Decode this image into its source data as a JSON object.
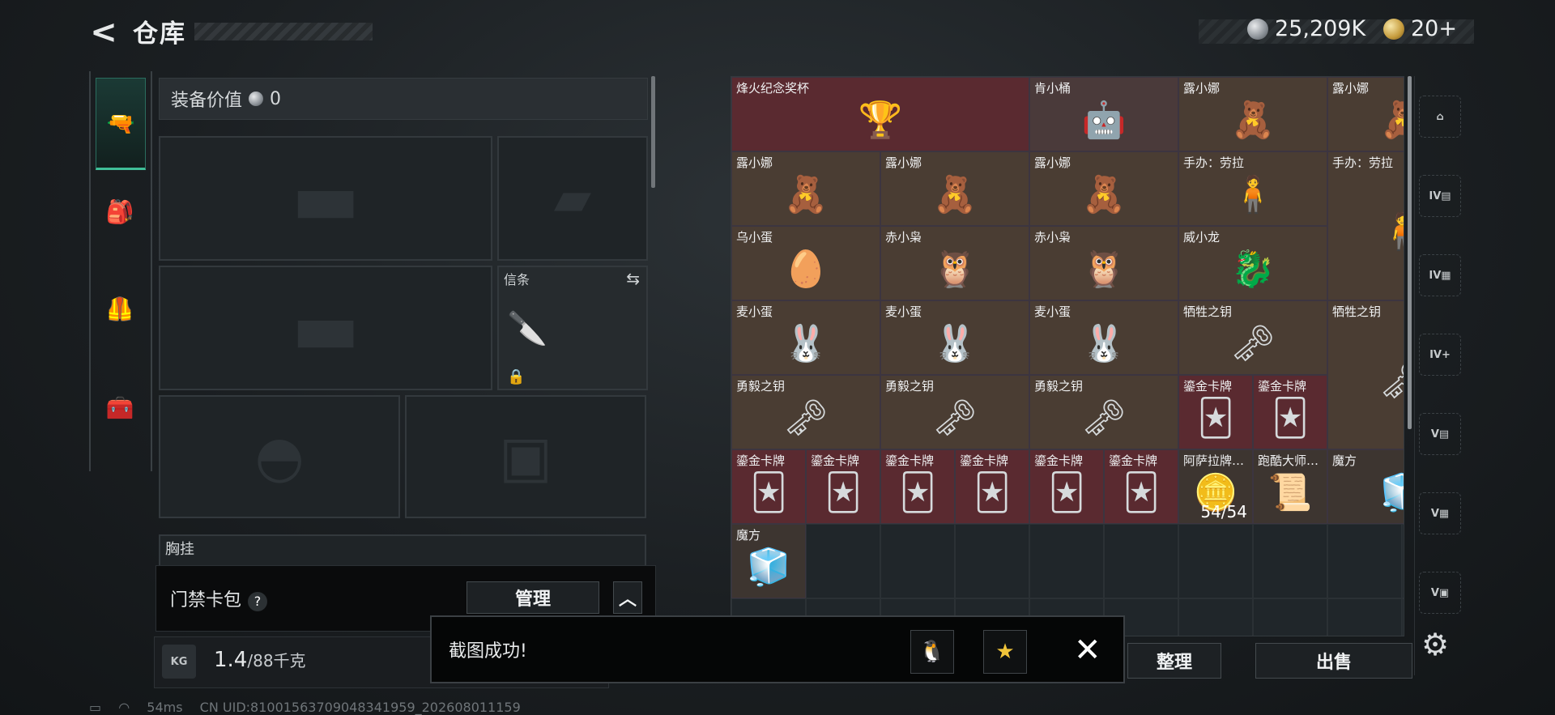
{
  "header": {
    "back_icon": "back-arrow-icon",
    "title": "仓库",
    "currency": [
      {
        "icon": "silver-coin-icon",
        "value": "25,209K"
      },
      {
        "icon": "gold-coin-icon",
        "value": "20+"
      }
    ]
  },
  "left_tabs": [
    {
      "icon": "pistol-icon",
      "glyph": "🔫",
      "active": true
    },
    {
      "icon": "backpack-icon",
      "glyph": "🎒",
      "active": false
    },
    {
      "icon": "vest-icon",
      "glyph": "🦺",
      "active": false
    },
    {
      "icon": "toolbox-icon",
      "glyph": "🧰",
      "active": false
    }
  ],
  "equipment": {
    "value_label": "装备价值",
    "value": "0",
    "signal_slot_label": "信条",
    "chest_label": "胸挂",
    "access_card_label": "门禁卡包",
    "help": "?",
    "manage_label": "管理",
    "collapse_glyph": "︿",
    "weight_icon_text": "KG",
    "weight_value": "1.4",
    "weight_max": "/88千克"
  },
  "items": [
    {
      "name": "烽火纪念奖杯",
      "glyph": "🏆",
      "color": "#5a2a30",
      "col": 0,
      "row": 0,
      "w": 2,
      "h": 1
    },
    {
      "name": "肯小桶",
      "glyph": "🤖",
      "color": "#4a3a3a",
      "col": 2,
      "row": 0,
      "w": 1,
      "h": 1
    },
    {
      "name": "露小娜",
      "glyph": "🧸",
      "color": "#4a3d33",
      "col": 3,
      "row": 0,
      "w": 1,
      "h": 1
    },
    {
      "name": "露小娜",
      "glyph": "🧸",
      "color": "#4a3d33",
      "col": 4,
      "row": 0,
      "w": 1,
      "h": 1
    },
    {
      "name": "露小娜",
      "glyph": "🧸",
      "color": "#4a3d33",
      "col": 0,
      "row": 1,
      "w": 1,
      "h": 1
    },
    {
      "name": "露小娜",
      "glyph": "🧸",
      "color": "#4a3d33",
      "col": 1,
      "row": 1,
      "w": 1,
      "h": 1
    },
    {
      "name": "露小娜",
      "glyph": "🧸",
      "color": "#4a3d33",
      "col": 2,
      "row": 1,
      "w": 1,
      "h": 1
    },
    {
      "name": "手办：劳拉",
      "glyph": "🧍",
      "color": "#4a3d33",
      "col": 3,
      "row": 1,
      "w": 1,
      "h": 1
    },
    {
      "name": "手办：劳拉",
      "glyph": "🧍",
      "color": "#4a3d33",
      "col": 4,
      "row": 1,
      "w": 1,
      "h": 2
    },
    {
      "name": "乌小蛋",
      "glyph": "🥚",
      "color": "#4a3d33",
      "col": 0,
      "row": 2,
      "w": 1,
      "h": 1
    },
    {
      "name": "赤小枭",
      "glyph": "🦉",
      "color": "#4a3d33",
      "col": 1,
      "row": 2,
      "w": 1,
      "h": 1
    },
    {
      "name": "赤小枭",
      "glyph": "🦉",
      "color": "#4a3d33",
      "col": 2,
      "row": 2,
      "w": 1,
      "h": 1
    },
    {
      "name": "威小龙",
      "glyph": "🐉",
      "color": "#4a3d33",
      "col": 3,
      "row": 2,
      "w": 1,
      "h": 1
    },
    {
      "name": "麦小蛋",
      "glyph": "🐰",
      "color": "#4a3d33",
      "col": 0,
      "row": 3,
      "w": 1,
      "h": 1
    },
    {
      "name": "麦小蛋",
      "glyph": "🐰",
      "color": "#4a3d33",
      "col": 1,
      "row": 3,
      "w": 1,
      "h": 1
    },
    {
      "name": "麦小蛋",
      "glyph": "🐰",
      "color": "#4a3d33",
      "col": 2,
      "row": 3,
      "w": 1,
      "h": 1
    },
    {
      "name": "牺牲之钥",
      "glyph": "🗝",
      "color": "#4a3d33",
      "col": 3,
      "row": 3,
      "w": 1,
      "h": 1
    },
    {
      "name": "牺牲之钥",
      "glyph": "🗝",
      "color": "#4a3d33",
      "col": 4,
      "row": 3,
      "w": 1,
      "h": 2
    },
    {
      "name": "勇毅之钥",
      "glyph": "🗝",
      "color": "#4a3d33",
      "col": 0,
      "row": 4,
      "w": 1,
      "h": 1
    },
    {
      "name": "勇毅之钥",
      "glyph": "🗝",
      "color": "#4a3d33",
      "col": 1,
      "row": 4,
      "w": 1,
      "h": 1
    },
    {
      "name": "勇毅之钥",
      "glyph": "🗝",
      "color": "#4a3d33",
      "col": 2,
      "row": 4,
      "w": 1,
      "h": 1
    },
    {
      "name": "鎏金卡牌",
      "glyph": "🃏",
      "color": "#5a2a30",
      "col": 3,
      "row": 4,
      "w": 0.5,
      "h": 1
    },
    {
      "name": "鎏金卡牌",
      "glyph": "🃏",
      "color": "#5a2a30",
      "col": 3.5,
      "row": 4,
      "w": 0.5,
      "h": 1
    },
    {
      "name": "鎏金卡牌",
      "glyph": "🃏",
      "color": "#5a2a30",
      "col": 0,
      "row": 5,
      "w": 0.5,
      "h": 1
    },
    {
      "name": "鎏金卡牌",
      "glyph": "🃏",
      "color": "#5a2a30",
      "col": 0.5,
      "row": 5,
      "w": 0.5,
      "h": 1
    },
    {
      "name": "鎏金卡牌",
      "glyph": "🃏",
      "color": "#5a2a30",
      "col": 1,
      "row": 5,
      "w": 0.5,
      "h": 1
    },
    {
      "name": "鎏金卡牌",
      "glyph": "🃏",
      "color": "#5a2a30",
      "col": 1.5,
      "row": 5,
      "w": 0.5,
      "h": 1
    },
    {
      "name": "鎏金卡牌",
      "glyph": "🃏",
      "color": "#5a2a30",
      "col": 2,
      "row": 5,
      "w": 0.5,
      "h": 1
    },
    {
      "name": "鎏金卡牌",
      "glyph": "🃏",
      "color": "#5a2a30",
      "col": 2.5,
      "row": 5,
      "w": 0.5,
      "h": 1
    },
    {
      "name": "阿萨拉牌…",
      "glyph": "🪙",
      "color": "#3d3530",
      "col": 3,
      "row": 5,
      "w": 0.5,
      "h": 1,
      "count": "54/54"
    },
    {
      "name": "跑酷大师…",
      "glyph": "📜",
      "color": "#3d3530",
      "col": 3.5,
      "row": 5,
      "w": 0.5,
      "h": 1
    },
    {
      "name": "魔方",
      "glyph": "🧊",
      "color": "#3d3530",
      "col": 4,
      "row": 5,
      "w": 1,
      "h": 1
    },
    {
      "name": "魔方",
      "glyph": "🧊",
      "color": "#3d3530",
      "col": 0,
      "row": 6,
      "w": 0.5,
      "h": 1
    }
  ],
  "right_sidebar": [
    {
      "icon": "safe-box-icon",
      "text": "⌂"
    },
    {
      "icon": "storage-iv-1-icon",
      "text": "IV▤"
    },
    {
      "icon": "storage-iv-2-icon",
      "text": "IV▦"
    },
    {
      "icon": "storage-iv-add-icon",
      "text": "IV+"
    },
    {
      "icon": "storage-v-1-icon",
      "text": "V▤"
    },
    {
      "icon": "storage-v-2-icon",
      "text": "V▦"
    },
    {
      "icon": "storage-v-3-icon",
      "text": "V▣"
    }
  ],
  "actions": {
    "sort_label": "整理",
    "sell_label": "出售",
    "settings_icon": "gear-icon"
  },
  "toast": {
    "text": "截图成功!",
    "qq_icon": "qq-share-icon",
    "favorite_icon": "star-share-icon",
    "close_icon": "close-icon"
  },
  "status_bar": {
    "ping": "54ms",
    "uid": "CN UID:81001563709048341959_202608011159"
  }
}
